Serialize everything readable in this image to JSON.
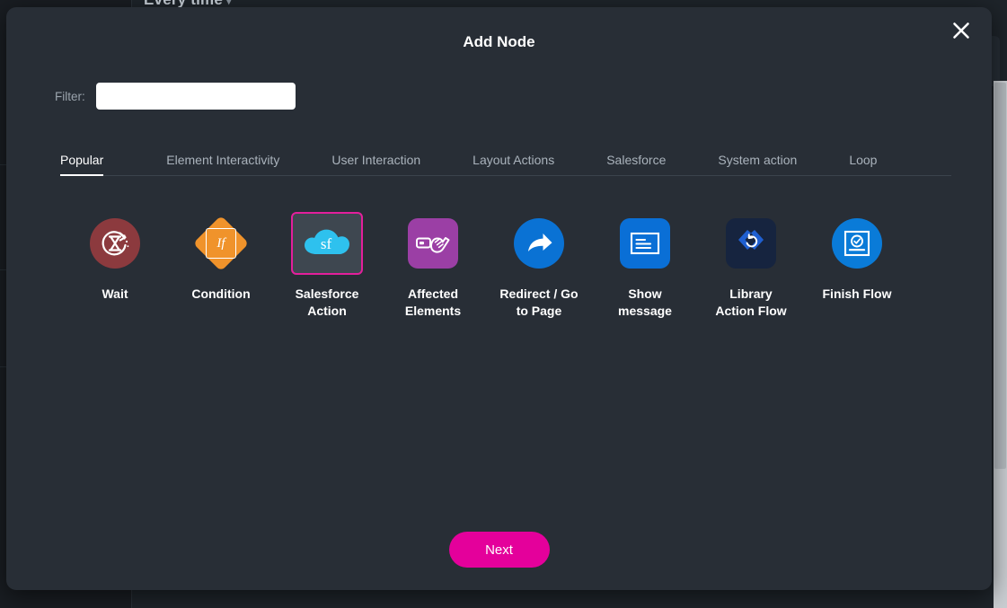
{
  "background": {
    "heading": "Every time",
    "heading_caret": "▾",
    "ghost_labels": [
      "",
      "",
      "",
      ""
    ]
  },
  "modal": {
    "title": "Add Node",
    "close_icon": "close-icon",
    "filter": {
      "label": "Filter:",
      "value": "",
      "placeholder": ""
    },
    "tabs": [
      {
        "label": "Popular",
        "active": true
      },
      {
        "label": "Element Interactivity",
        "active": false
      },
      {
        "label": "User Interaction",
        "active": false
      },
      {
        "label": "Layout Actions",
        "active": false
      },
      {
        "label": "Salesforce",
        "active": false
      },
      {
        "label": "System action",
        "active": false
      },
      {
        "label": "Loop",
        "active": false
      }
    ],
    "nodes": [
      {
        "label": "Wait",
        "icon": "hourglass-refresh-icon",
        "selected": false
      },
      {
        "label": "Condition",
        "icon": "if-diamond-icon",
        "selected": false
      },
      {
        "label": "Salesforce\nAction",
        "icon": "salesforce-cloud-icon",
        "selected": true
      },
      {
        "label": "Affected\nElements",
        "icon": "pointing-hand-icon",
        "selected": false
      },
      {
        "label": "Redirect / Go\nto Page",
        "icon": "share-arrow-icon",
        "selected": false
      },
      {
        "label": "Show\nmessage",
        "icon": "message-card-icon",
        "selected": false
      },
      {
        "label": "Library\nAction Flow",
        "icon": "library-flow-icon",
        "selected": false
      },
      {
        "label": "Finish Flow",
        "icon": "finish-check-icon",
        "selected": false
      }
    ],
    "next_label": "Next"
  },
  "colors": {
    "modal_bg": "#282e36",
    "accent_magenta": "#e4009b",
    "selected_border": "#e31f9c",
    "wait_red": "#8c3a3e",
    "condition_orange": "#f0932b",
    "salesforce_blue": "#2ec1ee",
    "affected_purple": "#9b3fa5",
    "redirect_blue": "#0a72d4",
    "message_blue": "#0a6fd6",
    "library_navy": "#16243f",
    "finish_blue": "#0a7bd8"
  }
}
